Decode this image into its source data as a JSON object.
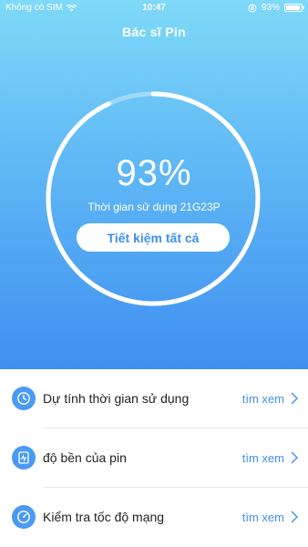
{
  "status_bar": {
    "carrier": "Không có SIM",
    "time": "10:47",
    "battery_text": "93%",
    "battery_level": 0.93
  },
  "header": {
    "title": "Bác sĩ Pin"
  },
  "battery": {
    "percent_text": "93%",
    "level": 0.93,
    "usage_text": "Thời gian sử dụng 21G23P",
    "save_all_label": "Tiết kiệm tất cả"
  },
  "menu": {
    "items": [
      {
        "label": "Dự tính thời gian sử dụng",
        "action": "tìm xem",
        "icon": "clock-icon"
      },
      {
        "label": "độ bền của pin",
        "action": "tìm xem",
        "icon": "battery-health-icon"
      },
      {
        "label": "Kiểm tra tốc độ mạng",
        "action": "tìm xem",
        "icon": "speedometer-icon"
      }
    ]
  },
  "colors": {
    "gradient_top": "#7fd9f8",
    "gradient_bottom": "#3f8ff0",
    "accent": "#3f8ff0",
    "icon_bg": "#4a9af2"
  }
}
